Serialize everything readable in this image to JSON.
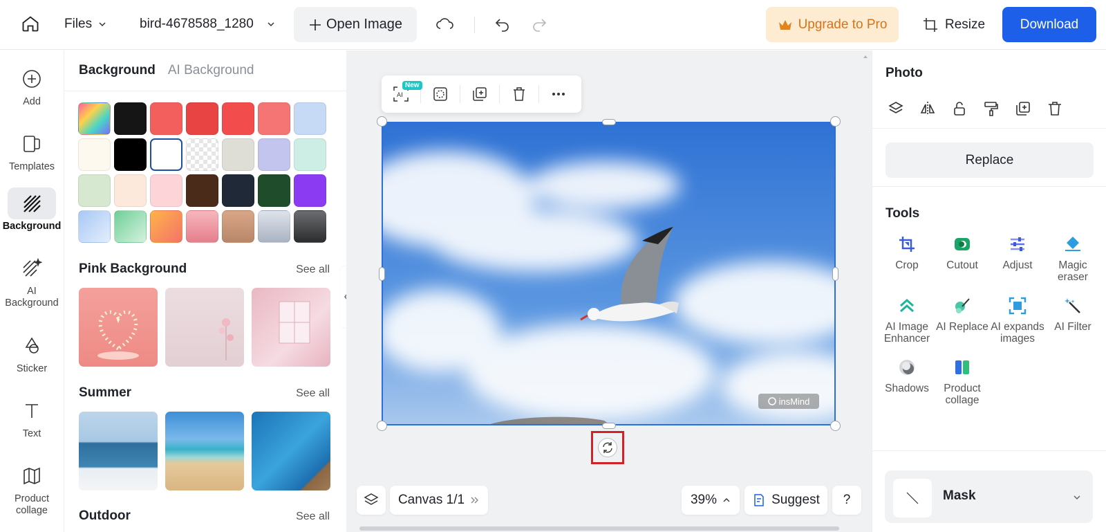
{
  "topbar": {
    "files_label": "Files",
    "filename": "bird-4678588_1280",
    "open_image": "Open Image",
    "upgrade": "Upgrade to Pro",
    "resize": "Resize",
    "download": "Download"
  },
  "rail": [
    {
      "label": "Add",
      "icon": "plus-circle-icon"
    },
    {
      "label": "Templates",
      "icon": "templates-icon"
    },
    {
      "label": "Background",
      "icon": "background-icon",
      "active": true
    },
    {
      "label": "AI Background",
      "icon": "ai-background-icon"
    },
    {
      "label": "Sticker",
      "icon": "sticker-icon"
    },
    {
      "label": "Text",
      "icon": "text-icon"
    },
    {
      "label": "Product collage",
      "icon": "product-collage-icon"
    }
  ],
  "bgpanel": {
    "tab_background": "Background",
    "tab_ai_background": "AI Background",
    "sections": [
      {
        "title": "Pink Background",
        "see_all": "See all"
      },
      {
        "title": "Summer",
        "see_all": "See all"
      },
      {
        "title": "Outdoor",
        "see_all": "See all"
      }
    ]
  },
  "swatch_colors": [
    "rainbow",
    "#151515",
    "#f25f5c",
    "#e84444",
    "#f24c4c",
    "#f57575",
    "#c6d9f5",
    "#fdf9ee",
    "#000000",
    "#ffffff",
    "checker",
    "#deddd6",
    "#c3c5ef",
    "#cdeee4",
    "#d6e8cf",
    "#fde9dc",
    "#fdd5d8",
    "#4a2b1a",
    "#1f2937",
    "#1f4d2b",
    "#8b3cf2",
    "grad-blue",
    "grad-green",
    "grad-orange",
    "grad-pink",
    "grad-tan",
    "grad-silver",
    "grad-dark"
  ],
  "canvas": {
    "badge_new": "New",
    "watermark": "insMind",
    "canvas_label": "Canvas 1/1",
    "zoom": "39%",
    "suggest": "Suggest",
    "help": "?"
  },
  "rpanel": {
    "photo_title": "Photo",
    "replace": "Replace",
    "tools_title": "Tools",
    "mask_title": "Mask",
    "tools": [
      {
        "label": "Crop",
        "icon": "crop-icon"
      },
      {
        "label": "Cutout",
        "icon": "cutout-icon"
      },
      {
        "label": "Adjust",
        "icon": "adjust-icon"
      },
      {
        "label": "Magic eraser",
        "icon": "magic-eraser-icon"
      },
      {
        "label": "AI Image Enhancer",
        "icon": "ai-enhancer-icon"
      },
      {
        "label": "AI Replace",
        "icon": "ai-replace-icon"
      },
      {
        "label": "AI expands images",
        "icon": "ai-expand-icon"
      },
      {
        "label": "AI Filter",
        "icon": "ai-filter-icon"
      },
      {
        "label": "Shadows",
        "icon": "shadows-icon"
      },
      {
        "label": "Product collage",
        "icon": "product-collage-tool-icon"
      }
    ]
  },
  "colors": {
    "accent": "#1d5fe8",
    "upgrade_bg": "#fdebd2",
    "upgrade_text": "#d6741a",
    "selection": "#2a6fdc",
    "highlight_box": "#d42127"
  }
}
